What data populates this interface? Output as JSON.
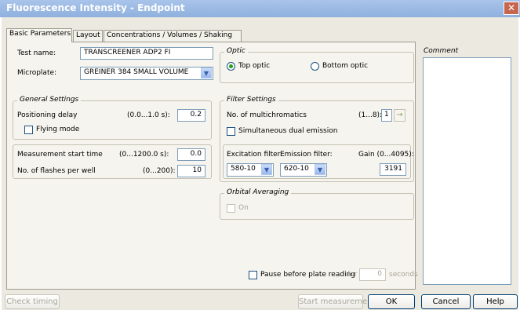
{
  "window": {
    "title": "Fluorescence Intensity  -  Endpoint",
    "close": "✕"
  },
  "tabs": [
    {
      "label": "Basic Parameters"
    },
    {
      "label": "Layout"
    },
    {
      "label": "Concentrations / Volumes / Shaking"
    }
  ],
  "test_name": {
    "label": "Test name:",
    "value": "TRANSCREENER ADP2 FI"
  },
  "microplate": {
    "label": "Microplate:",
    "value": "GREINER 384 SMALL VOLUME"
  },
  "optic": {
    "title": "Optic",
    "top": {
      "label": "Top optic",
      "selected": true
    },
    "bottom": {
      "label": "Bottom optic",
      "selected": false
    }
  },
  "comment": {
    "label": "Comment",
    "value": ""
  },
  "general_settings": {
    "title": "General Settings",
    "positioning_delay": {
      "label": "Positioning delay",
      "range": "(0.0...1.0 s):",
      "value": "0.2"
    },
    "flying_mode": {
      "label": "Flying mode",
      "checked": false
    }
  },
  "measurement": {
    "start_time": {
      "label": "Measurement start time",
      "range": "(0...1200.0 s):",
      "value": "0.0"
    },
    "flashes": {
      "label": "No. of flashes per well",
      "range": "(0...200):",
      "value": "10"
    }
  },
  "filter_settings": {
    "title": "Filter Settings",
    "multichromatics": {
      "label": "No. of multichromatics",
      "range": "(1...8):",
      "value": "1",
      "arrow": "→"
    },
    "dual_emission": {
      "label": "Simultaneous dual emission",
      "checked": false
    },
    "excitation": {
      "label": "Excitation filter:",
      "value": "580-10"
    },
    "emission": {
      "label": "Emission filter:",
      "value": "620-10"
    },
    "gain": {
      "label": "Gain (0...4095):",
      "value": "3191"
    }
  },
  "orbital": {
    "title": "Orbital Averaging",
    "on_label": "On",
    "checked": false
  },
  "pause": {
    "label": "Pause before plate reading",
    "for_label": "for",
    "value": "0",
    "unit": "seconds",
    "checked": false
  },
  "buttons": {
    "check_timing": "Check timing",
    "start_measurement": "Start measurement",
    "ok": "OK",
    "cancel": "Cancel",
    "help": "Help"
  },
  "icons": {
    "dropdown": "chevron-down-icon",
    "arrow": "arrow-right-icon",
    "radio_dot": "#21a121"
  }
}
